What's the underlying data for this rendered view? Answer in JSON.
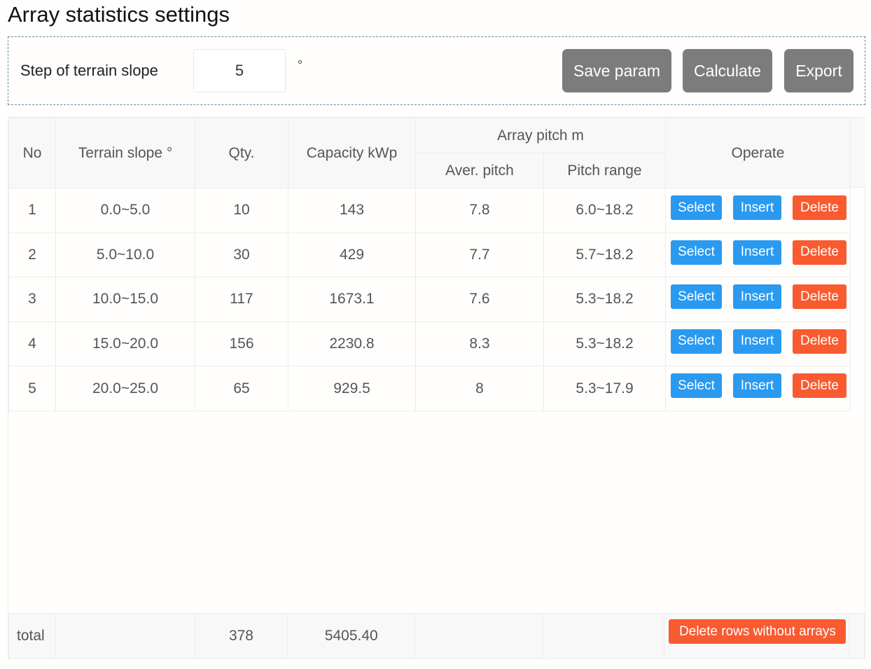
{
  "page": {
    "title": "Array statistics settings"
  },
  "params": {
    "step_label": "Step of terrain slope",
    "step_value": "5",
    "step_unit": "°",
    "save_label": "Save param",
    "calculate_label": "Calculate",
    "export_label": "Export"
  },
  "table": {
    "headers": {
      "no": "No",
      "slope": "Terrain slope °",
      "qty": "Qty.",
      "capacity": "Capacity kWp",
      "pitch_group": "Array pitch m",
      "aver_pitch": "Aver. pitch",
      "pitch_range": "Pitch range",
      "operate": "Operate"
    },
    "actions": {
      "select": "Select",
      "insert": "Insert",
      "delete": "Delete"
    },
    "rows": [
      {
        "no": "1",
        "slope": "0.0~5.0",
        "qty": "10",
        "capacity": "143",
        "aver_pitch": "7.8",
        "pitch_range": "6.0~18.2"
      },
      {
        "no": "2",
        "slope": "5.0~10.0",
        "qty": "30",
        "capacity": "429",
        "aver_pitch": "7.7",
        "pitch_range": "5.7~18.2"
      },
      {
        "no": "3",
        "slope": "10.0~15.0",
        "qty": "117",
        "capacity": "1673.1",
        "aver_pitch": "7.6",
        "pitch_range": "5.3~18.2"
      },
      {
        "no": "4",
        "slope": "15.0~20.0",
        "qty": "156",
        "capacity": "2230.8",
        "aver_pitch": "8.3",
        "pitch_range": "5.3~18.2"
      },
      {
        "no": "5",
        "slope": "20.0~25.0",
        "qty": "65",
        "capacity": "929.5",
        "aver_pitch": "8",
        "pitch_range": "5.3~17.9"
      }
    ],
    "totals": {
      "label": "total",
      "qty": "378",
      "capacity": "5405.40",
      "delete_rows_label": "Delete rows without arrays"
    }
  },
  "colors": {
    "primary_button": "#2a9af0",
    "danger_button": "#f95a30",
    "neutral_button": "#7c7c7c"
  }
}
